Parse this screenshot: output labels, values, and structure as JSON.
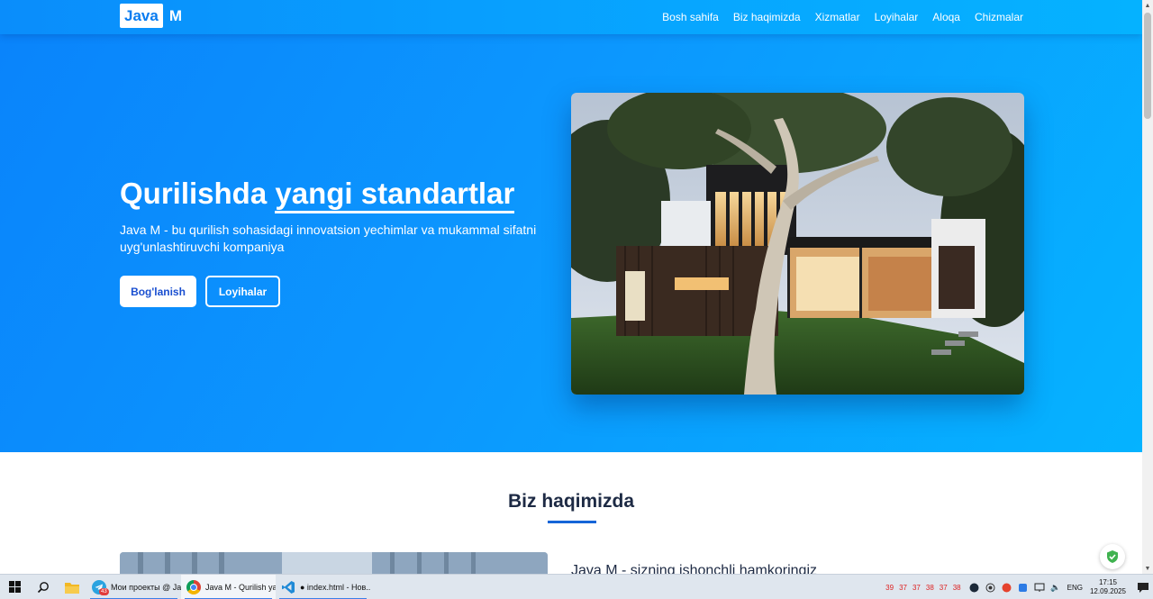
{
  "header": {
    "logo_box_text": "Java",
    "logo_suffix": "M",
    "nav": [
      "Bosh sahifa",
      "Biz haqimizda",
      "Xizmatlar",
      "Loyihalar",
      "Aloqa",
      "Chizmalar"
    ]
  },
  "hero": {
    "title_part1": "Qurilishda ",
    "title_highlight": "yangi standartlar",
    "description": "Java M - bu qurilish sohasidagi innovatsion yechimlar va mukammal sifatni uyg'unlashtiruvchi kompaniya",
    "primary_button": "Bog'lanish",
    "secondary_button": "Loyihalar",
    "image_icon": "modern-house-photo"
  },
  "about": {
    "title": "Biz haqimizda",
    "subtitle": "Java M - sizning ishonchli hamkoringiz",
    "image_icon": "building-photo"
  },
  "taskbar": {
    "apps": [
      {
        "label": "Мои проекты @ Ja...",
        "icon": "telegram-icon",
        "badge": "43"
      },
      {
        "label": "Java M - Qurilish ya...",
        "icon": "chrome-icon"
      },
      {
        "label": "● index.html - Нов...",
        "icon": "vscode-icon"
      }
    ],
    "tray_numbers": [
      "39",
      "37",
      "37",
      "38",
      "37",
      "38"
    ],
    "language": "ENG",
    "time": "17:15",
    "date": "12.09.2025"
  },
  "colors": {
    "hero_gradient_start": "#0a84fb",
    "hero_gradient_end": "#05b3ff",
    "primary_text": "#1a4fd0",
    "heading_dark": "#1d2a44",
    "underline": "#1565d8"
  }
}
